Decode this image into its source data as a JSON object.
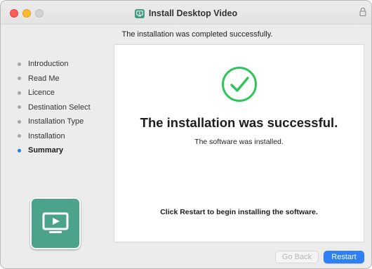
{
  "window": {
    "title": "Install Desktop Video",
    "header_message": "The installation was completed successfully."
  },
  "sidebar": {
    "steps": [
      {
        "label": "Introduction",
        "active": false
      },
      {
        "label": "Read Me",
        "active": false
      },
      {
        "label": "Licence",
        "active": false
      },
      {
        "label": "Destination Select",
        "active": false
      },
      {
        "label": "Installation Type",
        "active": false
      },
      {
        "label": "Installation",
        "active": false
      },
      {
        "label": "Summary",
        "active": true
      }
    ]
  },
  "content": {
    "success_title": "The installation was successful.",
    "success_subtitle": "The software was installed.",
    "restart_hint": "Click Restart to begin installing the software."
  },
  "buttons": {
    "go_back": "Go Back",
    "restart": "Restart"
  },
  "icons": {
    "title": "desktop-video-icon",
    "lock": "lock-icon",
    "check": "checkmark-circle-icon",
    "app": "desktop-video-app-icon"
  },
  "colors": {
    "accent": "#2f80f6",
    "success": "#2ec55a",
    "app_icon": "#4aa38a",
    "active_step_dot": "#2a78f2"
  }
}
